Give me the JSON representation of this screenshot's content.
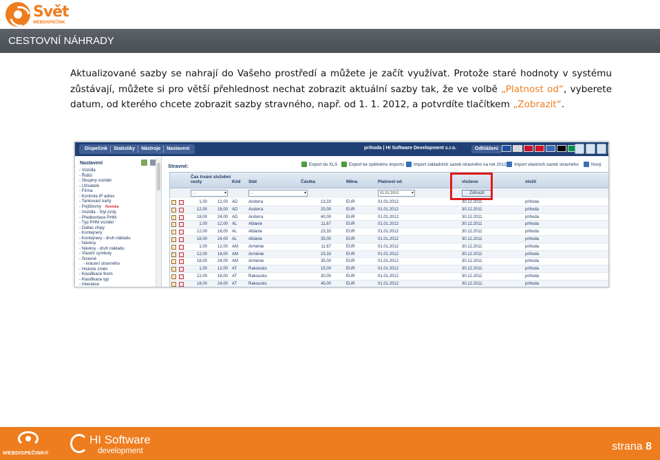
{
  "header": {
    "logo_word": "Svět",
    "logo_sub": "WEBDISPEČINK",
    "title": "CESTOVNÍ NÁHRADY"
  },
  "intro": {
    "part1": "Aktualizované sazby se nahrají do Vašeho prostředí a můžete je začít využívat. Protože staré hodnoty v systému zůstávají, můžete si pro větší přehlednost nechat zobrazit aktuální sazby tak, že ve volbě ",
    "highlight1": "„Platnost od“",
    "part2": ", vyberete datum, od kterého chcete zobrazit sazby stravného, např. od 1. 1. 2012, a potvrdíte tlačítkem ",
    "highlight2": "„Zobrazit“",
    "part3": "."
  },
  "app": {
    "menu": [
      "Dispečink",
      "Statistiky",
      "Nástroje",
      "Nastavení"
    ],
    "user": "prihoda | HI Software Development s.r.o.",
    "logout": "Odhlášeni",
    "flag_colors": [
      "#1c4fa0",
      "#d8d8d8",
      "#c8102e",
      "#cf142b",
      "#3a6ab6",
      "#000000",
      "#009246"
    ],
    "sidebar": {
      "title": "Nastavení",
      "items": [
        {
          "label": "- Vozidla",
          "sub": false
        },
        {
          "label": "- Řidiči",
          "sub": false
        },
        {
          "label": "- Skupiny vozidel",
          "sub": false
        },
        {
          "label": "- Uživatelé",
          "sub": false
        },
        {
          "label": "- Firma",
          "sub": false
        },
        {
          "label": "- Kontrola IP adres",
          "sub": false
        },
        {
          "label": "- Tankovací karty",
          "sub": false
        },
        {
          "label": "- Pojištovny",
          "sub": false,
          "badge": "Novinka"
        },
        {
          "label": "- Vozidla - Styl jízdy",
          "sub": false
        },
        {
          "label": "- Předkontace PHM",
          "sub": false
        },
        {
          "label": "- Typ PHM vozidel",
          "sub": false
        },
        {
          "label": "- Dallas chipy",
          "sub": false
        },
        {
          "label": "- Kontejnery",
          "sub": false
        },
        {
          "label": "- Kontejnery - druh nákladu",
          "sub": false
        },
        {
          "label": "- Návěsy",
          "sub": false
        },
        {
          "label": "- Návěsy - druh nákladu",
          "sub": false
        },
        {
          "label": "- Vlastní symboly",
          "sub": false
        },
        {
          "label": "- Stravné",
          "sub": false
        },
        {
          "label": "- krácení stravného",
          "sub": true
        },
        {
          "label": "- Historie změn",
          "sub": false
        },
        {
          "label": "- Klasifikace firem",
          "sub": false
        },
        {
          "label": "- Klasifikace typ",
          "sub": false
        },
        {
          "label": "- Interakce",
          "sub": false
        }
      ]
    },
    "content_title": "Stravné:",
    "actions": [
      "Export do XLS",
      "Export ke zpětnému importu",
      "Import základních sazeb stravného na rok 2012",
      "Import vlastních sazeb stravného",
      "Nový"
    ],
    "columns": {
      "duration": "Čas trvání služební cesty",
      "code": "Kód",
      "state": "Stát",
      "amount": "Částka",
      "currency": "Měna",
      "valid_from": "Platnost od",
      "inserted": "vloženo",
      "inserted_by": "vložil"
    },
    "filters": {
      "duration": "...",
      "code": "...",
      "valid_from": "01.01.2012",
      "button": "Zobrazit"
    },
    "rows": [
      [
        "1,00",
        "12,00",
        "AD",
        "Andorra",
        "13,33",
        "EUR",
        "01.01.2012",
        "30.12.2011",
        "prihoda"
      ],
      [
        "12,00",
        "18,00",
        "AD",
        "Andorra",
        "20,00",
        "EUR",
        "01.01.2012",
        "30.12.2011",
        "prihoda"
      ],
      [
        "18,00",
        "24,00",
        "AD",
        "Andorra",
        "40,00",
        "EUR",
        "01.01.2012",
        "30.12.2011",
        "prihoda"
      ],
      [
        "1,00",
        "12,00",
        "AL",
        "Albánie",
        "11,67",
        "EUR",
        "01.01.2012",
        "30.12.2011",
        "prihoda"
      ],
      [
        "12,00",
        "18,00",
        "AL",
        "Albánie",
        "23,33",
        "EUR",
        "01.01.2012",
        "30.12.2011",
        "prihoda"
      ],
      [
        "18,00",
        "24,00",
        "AL",
        "Albánie",
        "35,00",
        "EUR",
        "01.01.2012",
        "30.12.2011",
        "prihoda"
      ],
      [
        "1,00",
        "12,00",
        "AM",
        "Arménie",
        "11,67",
        "EUR",
        "01.01.2012",
        "30.12.2011",
        "prihoda"
      ],
      [
        "12,00",
        "18,00",
        "AM",
        "Arménie",
        "23,33",
        "EUR",
        "01.01.2012",
        "30.12.2011",
        "prihoda"
      ],
      [
        "18,00",
        "24,00",
        "AM",
        "Arménie",
        "35,00",
        "EUR",
        "01.01.2012",
        "30.12.2011",
        "prihoda"
      ],
      [
        "1,00",
        "12,00",
        "AT",
        "Rakousko",
        "15,00",
        "EUR",
        "01.01.2012",
        "30.12.2011",
        "prihoda"
      ],
      [
        "12,00",
        "18,00",
        "AT",
        "Rakousko",
        "30,00",
        "EUR",
        "01.01.2012",
        "30.12.2011",
        "prihoda"
      ],
      [
        "18,00",
        "24,00",
        "AT",
        "Rakousko",
        "45,00",
        "EUR",
        "01.01.2012",
        "30.12.2011",
        "prihoda"
      ]
    ]
  },
  "footer": {
    "logo1": "WEBDISPEČINK®",
    "logo2_top": "HI Software",
    "logo2_bottom": "development",
    "page_label": "strana",
    "page_number": "8"
  },
  "colors": {
    "accent": "#ee7d1f",
    "title_bar": "#4f545b",
    "app_nav": "#1f3f75",
    "highlight_box": "#e11a1a"
  }
}
